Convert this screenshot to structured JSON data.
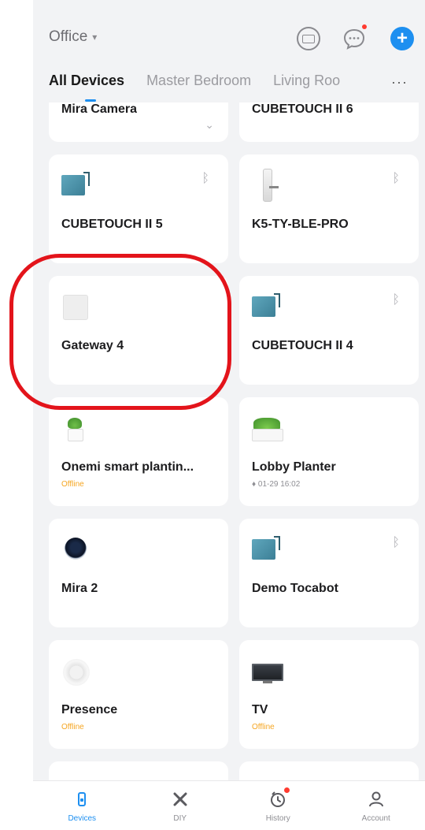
{
  "header": {
    "home_name": "Office",
    "caret_glyph": "▾",
    "add_glyph": "+",
    "more_glyph": "···",
    "icons": [
      "message-icon",
      "chat-icon",
      "add-icon"
    ]
  },
  "tabs": [
    {
      "label": "All Devices",
      "active": true
    },
    {
      "label": "Master Bedroom",
      "active": false
    },
    {
      "label": "Living Roo",
      "active": false
    }
  ],
  "devices": [
    {
      "name": "Mira Camera",
      "status": "",
      "icon": "camera-icon"
    },
    {
      "name": "CUBETOUCH II 6",
      "status": "",
      "icon": "cubetouch-icon"
    },
    {
      "name": "CUBETOUCH II 5",
      "status": "",
      "icon": "cubetouch-icon",
      "bluetooth": true
    },
    {
      "name": "K5-TY-BLE-PRO",
      "status": "",
      "icon": "lock-icon",
      "bluetooth": true
    },
    {
      "name": "Gateway 4",
      "status": "",
      "icon": "gateway-icon"
    },
    {
      "name": "CUBETOUCH II 4",
      "status": "",
      "icon": "cubetouch-icon",
      "bluetooth": true
    },
    {
      "name": "Onemi smart plantin...",
      "status": "Offline",
      "icon": "plant-icon"
    },
    {
      "name": "Lobby Planter",
      "status": "♦ 01-29 16:02",
      "icon": "planter-icon"
    },
    {
      "name": "Mira 2",
      "status": "",
      "icon": "camera-icon"
    },
    {
      "name": "Demo Tocabot",
      "status": "",
      "icon": "cubetouch-icon",
      "bluetooth": true
    },
    {
      "name": "Presence",
      "status": "Offline",
      "icon": "presence-sensor-icon"
    },
    {
      "name": "TV",
      "status": "Offline",
      "icon": "tv-icon"
    }
  ],
  "bluetooth_glyph": "ᛒ",
  "chevron_glyph": "⌄",
  "bottom_nav": [
    {
      "label": "Devices",
      "icon": "devices-icon",
      "active": true
    },
    {
      "label": "DIY",
      "icon": "diy-icon",
      "active": false
    },
    {
      "label": "History",
      "icon": "history-icon",
      "active": false
    },
    {
      "label": "Account",
      "icon": "account-icon",
      "active": false
    }
  ],
  "colors": {
    "accent": "#1d8ff0",
    "offline": "#f5a623",
    "annotation": "#e3141b"
  }
}
